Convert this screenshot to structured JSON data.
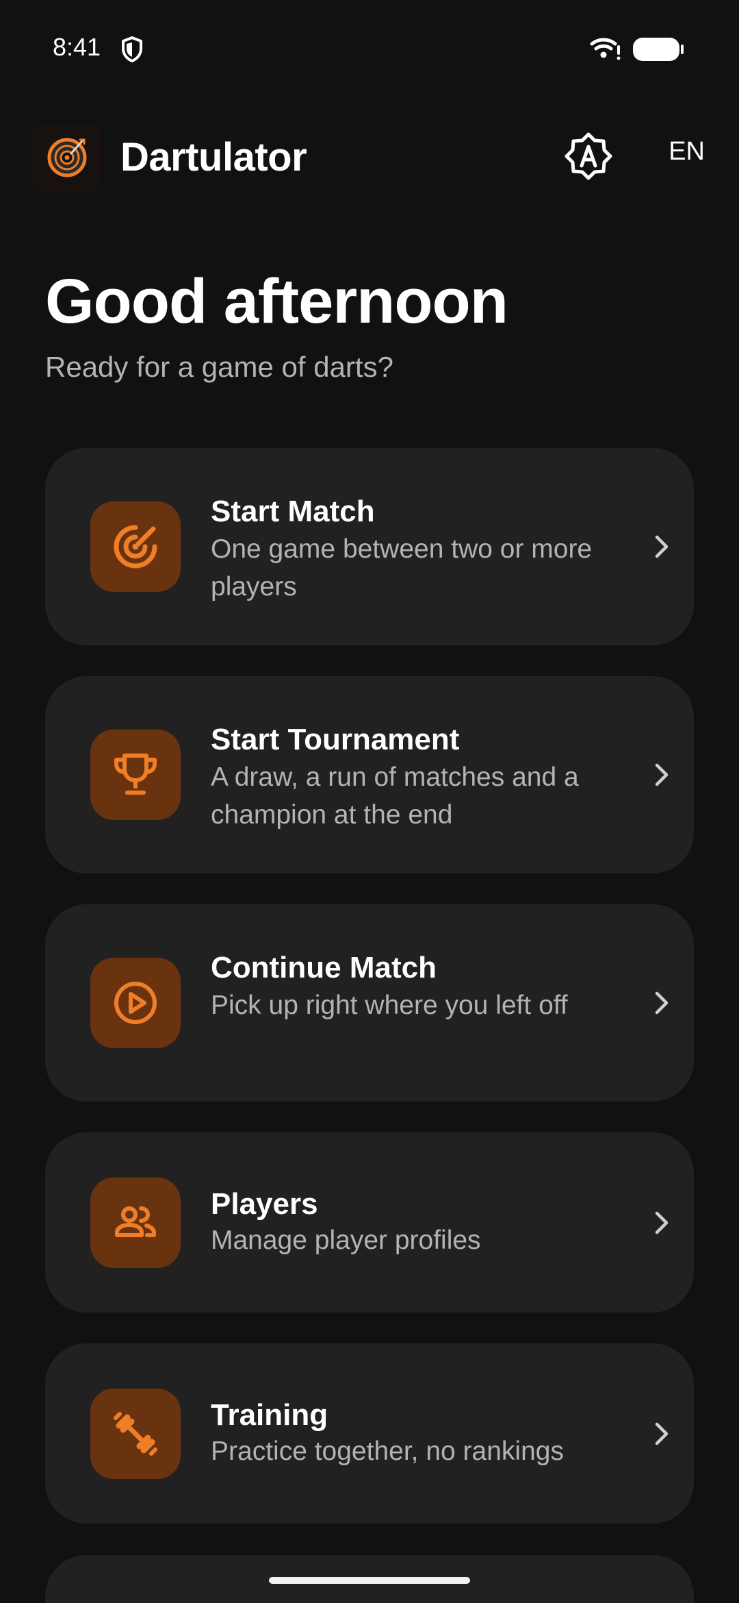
{
  "status_bar": {
    "time": "8:41",
    "icons": [
      "shield-icon",
      "wifi-icon",
      "battery-icon"
    ]
  },
  "header": {
    "app_title": "Dartulator",
    "language": "EN",
    "icons": [
      "dartboard-logo-icon",
      "auto-brightness-icon"
    ]
  },
  "greeting": {
    "title": "Good afternoon",
    "subtitle": "Ready for a game of darts?"
  },
  "menu": {
    "items": [
      {
        "title": "Start Match",
        "description": "One game between two or more players",
        "icon": "target-icon"
      },
      {
        "title": "Start Tournament",
        "description": "A draw, a run of matches and a champion at the end",
        "icon": "trophy-icon"
      },
      {
        "title": "Continue Match",
        "description": "Pick up right where you left off",
        "icon": "play-circle-icon"
      },
      {
        "title": "Players",
        "description": "Manage player profiles",
        "icon": "people-icon"
      },
      {
        "title": "Training",
        "description": "Practice together, no rankings",
        "icon": "dumbbell-icon"
      }
    ]
  },
  "colors": {
    "background": "#111111",
    "card": "#212121",
    "accent": "#f07e26",
    "icon_tile": "#6a3310",
    "secondary_text": "#b3b3b3"
  }
}
